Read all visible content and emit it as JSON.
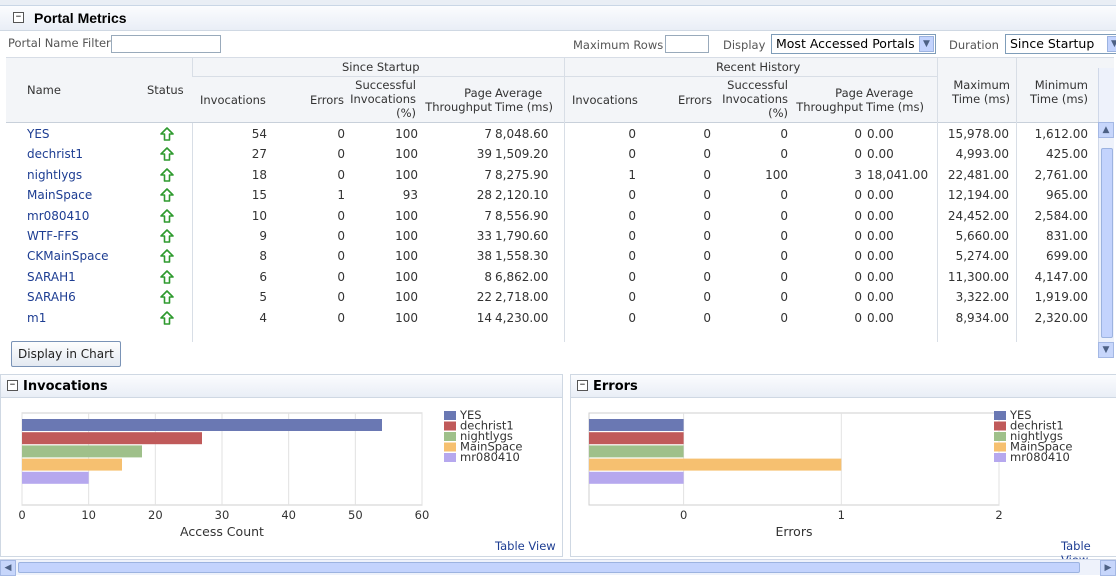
{
  "panel": {
    "title": "Portal Metrics"
  },
  "toolbar": {
    "filter_label": "Portal Name Filter",
    "filter_value": "",
    "max_rows_label": "Maximum Rows",
    "max_rows_value": "",
    "display_label": "Display",
    "display_value": "Most Accessed Portals",
    "duration_label": "Duration",
    "duration_value": "Since Startup"
  },
  "table": {
    "group_since": "Since Startup",
    "group_recent": "Recent History",
    "col_name": "Name",
    "col_status": "Status",
    "col_invocations": "Invocations",
    "col_errors": "Errors",
    "col_success_l1": "Successful",
    "col_success_l2": "Invocations",
    "col_success_l3": "(%)",
    "col_page_l1": "Page",
    "col_page_l2": "Throughput",
    "col_avg_l1": "Average",
    "col_avg_l2": "Time (ms)",
    "col_max_l1": "Maximum",
    "col_max_l2": "Time (ms)",
    "col_min_l1": "Minimum",
    "col_min_l2": "Time (ms)",
    "rows": [
      {
        "name": "YES",
        "s_inv": "54",
        "s_err": "0",
        "s_succ": "100",
        "s_page": "7",
        "s_avg": "8,048.60",
        "r_inv": "0",
        "r_err": "0",
        "r_succ": "0",
        "r_page": "0",
        "r_avg": "0.00",
        "max": "15,978.00",
        "min": "1,612.00"
      },
      {
        "name": "dechrist1",
        "s_inv": "27",
        "s_err": "0",
        "s_succ": "100",
        "s_page": "39",
        "s_avg": "1,509.20",
        "r_inv": "0",
        "r_err": "0",
        "r_succ": "0",
        "r_page": "0",
        "r_avg": "0.00",
        "max": "4,993.00",
        "min": "425.00"
      },
      {
        "name": "nightlygs",
        "s_inv": "18",
        "s_err": "0",
        "s_succ": "100",
        "s_page": "7",
        "s_avg": "8,275.90",
        "r_inv": "1",
        "r_err": "0",
        "r_succ": "100",
        "r_page": "3",
        "r_avg": "18,041.00",
        "max": "22,481.00",
        "min": "2,761.00"
      },
      {
        "name": "MainSpace",
        "s_inv": "15",
        "s_err": "1",
        "s_succ": "93",
        "s_page": "28",
        "s_avg": "2,120.10",
        "r_inv": "0",
        "r_err": "0",
        "r_succ": "0",
        "r_page": "0",
        "r_avg": "0.00",
        "max": "12,194.00",
        "min": "965.00"
      },
      {
        "name": "mr080410",
        "s_inv": "10",
        "s_err": "0",
        "s_succ": "100",
        "s_page": "7",
        "s_avg": "8,556.90",
        "r_inv": "0",
        "r_err": "0",
        "r_succ": "0",
        "r_page": "0",
        "r_avg": "0.00",
        "max": "24,452.00",
        "min": "2,584.00"
      },
      {
        "name": "WTF-FFS",
        "s_inv": "9",
        "s_err": "0",
        "s_succ": "100",
        "s_page": "33",
        "s_avg": "1,790.60",
        "r_inv": "0",
        "r_err": "0",
        "r_succ": "0",
        "r_page": "0",
        "r_avg": "0.00",
        "max": "5,660.00",
        "min": "831.00"
      },
      {
        "name": "CKMainSpace",
        "s_inv": "8",
        "s_err": "0",
        "s_succ": "100",
        "s_page": "38",
        "s_avg": "1,558.30",
        "r_inv": "0",
        "r_err": "0",
        "r_succ": "0",
        "r_page": "0",
        "r_avg": "0.00",
        "max": "5,274.00",
        "min": "699.00"
      },
      {
        "name": "SARAH1",
        "s_inv": "6",
        "s_err": "0",
        "s_succ": "100",
        "s_page": "8",
        "s_avg": "6,862.00",
        "r_inv": "0",
        "r_err": "0",
        "r_succ": "0",
        "r_page": "0",
        "r_avg": "0.00",
        "max": "11,300.00",
        "min": "4,147.00"
      },
      {
        "name": "SARAH6",
        "s_inv": "5",
        "s_err": "0",
        "s_succ": "100",
        "s_page": "22",
        "s_avg": "2,718.00",
        "r_inv": "0",
        "r_err": "0",
        "r_succ": "0",
        "r_page": "0",
        "r_avg": "0.00",
        "max": "3,322.00",
        "min": "1,919.00"
      },
      {
        "name": "m1",
        "s_inv": "4",
        "s_err": "0",
        "s_succ": "100",
        "s_page": "14",
        "s_avg": "4,230.00",
        "r_inv": "0",
        "r_err": "0",
        "r_succ": "0",
        "r_page": "0",
        "r_avg": "0.00",
        "max": "8,934.00",
        "min": "2,320.00"
      }
    ]
  },
  "display_chart_button": "Display in Chart",
  "colors": {
    "series": [
      "#6a78b3",
      "#c05a5a",
      "#9fc08a",
      "#f6c070",
      "#b6a8ee"
    ],
    "status_up": "#2e9a2e"
  },
  "chart_data": [
    {
      "type": "bar",
      "title": "Invocations",
      "categories": [
        "YES",
        "dechrist1",
        "nightlygs",
        "MainSpace",
        "mr080410"
      ],
      "values": [
        54,
        27,
        18,
        15,
        10
      ],
      "xlabel": "Access Count",
      "xticks": [
        "0",
        "10",
        "20",
        "30",
        "40",
        "50",
        "60"
      ],
      "xlim": [
        0,
        60
      ],
      "grid": true,
      "legend": "right",
      "link": "Table View"
    },
    {
      "type": "bar",
      "title": "Errors",
      "categories": [
        "YES",
        "dechrist1",
        "nightlygs",
        "MainSpace",
        "mr080410"
      ],
      "values": [
        0,
        0,
        0,
        1,
        0
      ],
      "xlabel": "Errors",
      "xticks": [
        "0",
        "1",
        "2"
      ],
      "xlim": [
        -0.6,
        2.0
      ],
      "grid": true,
      "legend": "right",
      "link": "Table View"
    }
  ]
}
